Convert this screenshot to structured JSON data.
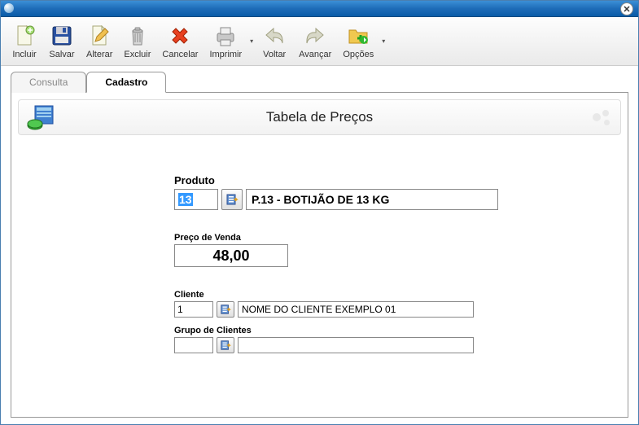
{
  "toolbar": {
    "incluir": "Incluir",
    "salvar": "Salvar",
    "alterar": "Alterar",
    "excluir": "Excluir",
    "cancelar": "Cancelar",
    "imprimir": "Imprimir",
    "voltar": "Voltar",
    "avancar": "Avançar",
    "opcoes": "Opções"
  },
  "tabs": {
    "consulta": "Consulta",
    "cadastro": "Cadastro"
  },
  "panel": {
    "title": "Tabela de Preços"
  },
  "form": {
    "produto_label": "Produto",
    "produto_code": "13",
    "produto_desc": "P.13 - BOTIJÃO DE 13 KG",
    "preco_label": "Preço de Venda",
    "preco_value": "48,00",
    "cliente_label": "Cliente",
    "cliente_code": "1",
    "cliente_desc": "NOME DO CLIENTE EXEMPLO 01",
    "grupo_label": "Grupo de Clientes",
    "grupo_code": "",
    "grupo_desc": ""
  }
}
